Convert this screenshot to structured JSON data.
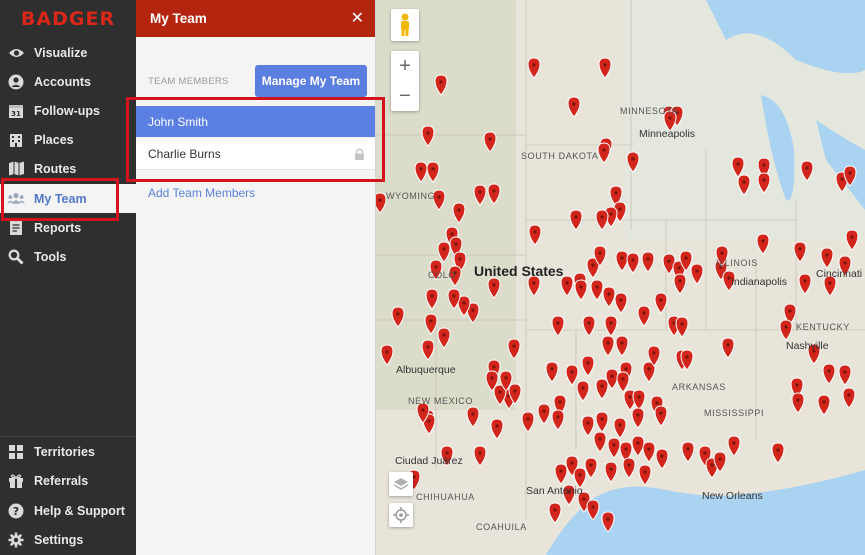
{
  "app": {
    "logo_text": "BADGER"
  },
  "sidebar": {
    "items": [
      {
        "label": "Visualize",
        "icon": "eye-icon"
      },
      {
        "label": "Accounts",
        "icon": "user-circle-icon"
      },
      {
        "label": "Follow-ups",
        "icon": "calendar-icon",
        "badge": "31"
      },
      {
        "label": "Places",
        "icon": "building-icon"
      },
      {
        "label": "Routes",
        "icon": "map-icon"
      },
      {
        "label": "My Team",
        "icon": "team-icon",
        "active": true
      },
      {
        "label": "Reports",
        "icon": "report-icon"
      },
      {
        "label": "Tools",
        "icon": "tools-icon"
      }
    ],
    "bottom_items": [
      {
        "label": "Territories",
        "icon": "territories-icon"
      },
      {
        "label": "Referrals",
        "icon": "gift-icon"
      },
      {
        "label": "Help & Support",
        "icon": "help-icon"
      },
      {
        "label": "Settings",
        "icon": "gear-icon"
      }
    ]
  },
  "panel": {
    "title": "My Team",
    "close_symbol": "✕",
    "section_label": "TEAM MEMBERS",
    "manage_button": "Manage My Team",
    "members": [
      {
        "name": "John Smith",
        "selected": true,
        "locked": false
      },
      {
        "name": "Charlie Burns",
        "selected": false,
        "locked": true
      }
    ],
    "add_link": "Add Team Members"
  },
  "map": {
    "zoom_in": "+",
    "zoom_out": "−",
    "labels": {
      "minnesota": "MINNESOTA",
      "minneapolis": "Minneapolis",
      "south_dakota": "SOUTH DAKOTA",
      "wyoming": "WYOMING",
      "united_states": "United States",
      "colorado": "COLO",
      "illinois": "ILLINOIS",
      "indianapolis": "Indianapolis",
      "cincinnati": "Cincinnati",
      "kentucky": "KENTUCKY",
      "nashville": "Nashville",
      "arkansas": "ARKANSAS",
      "albuquerque": "Albuquerque",
      "new_mexico": "NEW MEXICO",
      "mississippi": "MISSISSIPPI",
      "ciudad_juarez": "Ciudad Juárez",
      "chihuahua": "CHIHUAHUA",
      "coahuila": "COAHUILA",
      "san_antonio": "San Antonio",
      "new_orleans": "New Orleans"
    },
    "colors": {
      "marker": "#d2261c",
      "water": "#a9d3f0",
      "land": "#e8e4da",
      "accent": "#5b7fe0",
      "brand": "#b4250f"
    }
  }
}
